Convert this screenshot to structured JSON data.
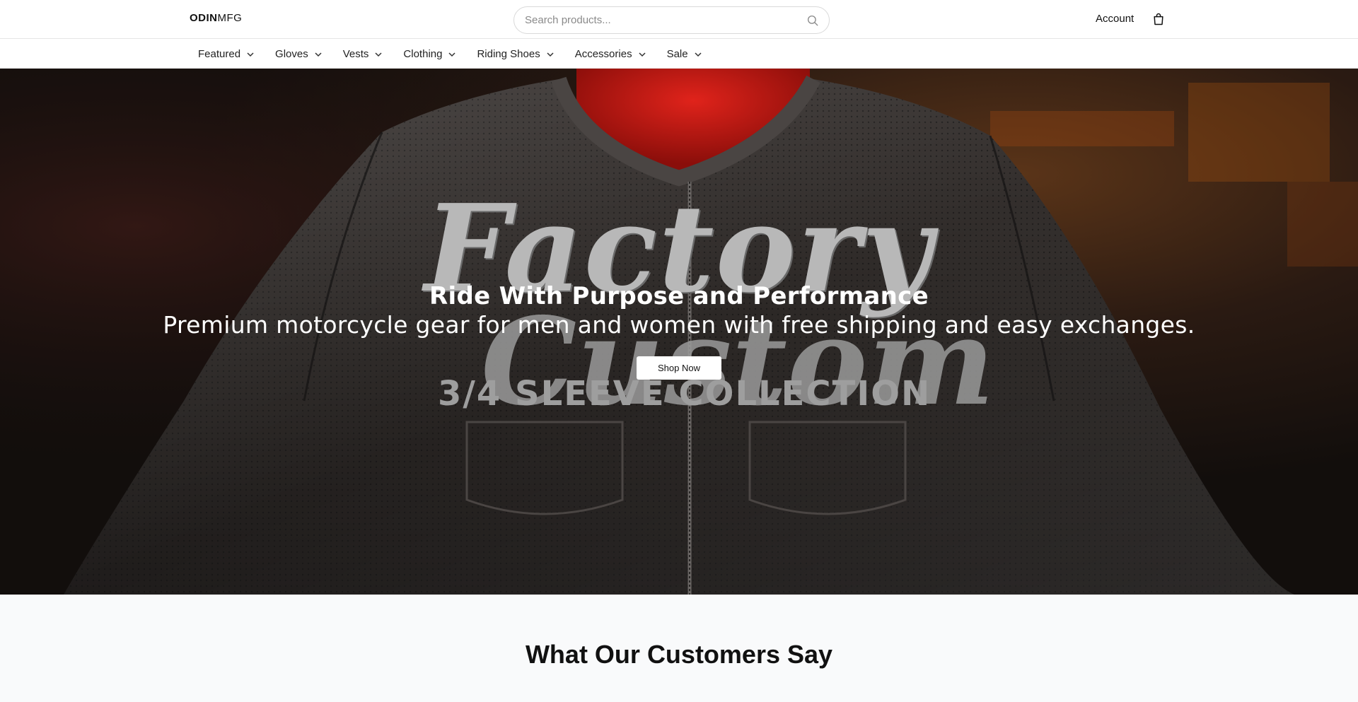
{
  "brand": {
    "strong": "ODIN",
    "light": "MFG"
  },
  "search": {
    "placeholder": "Search products..."
  },
  "header": {
    "account_label": "Account"
  },
  "nav": {
    "items": [
      {
        "label": "Featured"
      },
      {
        "label": "Gloves"
      },
      {
        "label": "Vests"
      },
      {
        "label": "Clothing"
      },
      {
        "label": "Riding Shoes"
      },
      {
        "label": "Accessories"
      },
      {
        "label": "Sale"
      }
    ]
  },
  "hero": {
    "art_line1": "Factory",
    "art_line2": "Custom",
    "art_collection": "3/4 SLEEVE COLLECTION",
    "headline": "Ride With Purpose and Performance",
    "subheadline": "Premium motorcycle gear for men and women with free shipping and easy exchanges.",
    "cta_label": "Shop Now"
  },
  "reviews": {
    "title": "What Our Customers Say"
  },
  "colors": {
    "hero_bg": "#1a1512",
    "jacket": "#2a2624",
    "lining_red": "#c8140f",
    "reviews_bg": "#f9fafb"
  },
  "icons": {
    "search": "search-icon",
    "cart": "shopping-bag-icon",
    "chevron": "chevron-down-icon"
  }
}
